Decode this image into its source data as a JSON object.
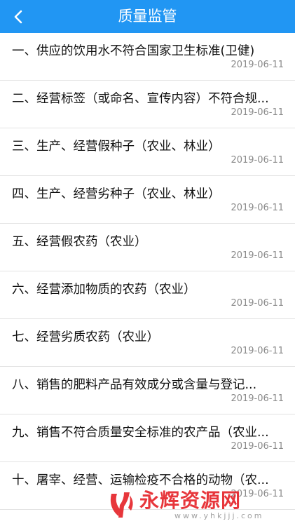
{
  "header": {
    "title": "质量监管",
    "back_icon": "chevron-left-icon",
    "color": "#2196F3"
  },
  "items": [
    {
      "title": "一、供应的饮用水不符合国家卫生标准(卫健)",
      "date": "2019-06-11"
    },
    {
      "title": "二、经营标签（或命名、宣传内容）不符合规...",
      "date": "2019-06-11"
    },
    {
      "title": "三、生产、经营假种子（农业、林业）",
      "date": "2019-06-11"
    },
    {
      "title": "四、生产、经营劣种子（农业、林业）",
      "date": "2019-06-11"
    },
    {
      "title": "五、经营假农药（农业）",
      "date": "2019-06-11"
    },
    {
      "title": "六、经营添加物质的农药（农业）",
      "date": "2019-06-11"
    },
    {
      "title": "七、经营劣质农药（农业）",
      "date": "2019-06-11"
    },
    {
      "title": "八、销售的肥料产品有效成分或含量与登记...",
      "date": "2019-06-11"
    },
    {
      "title": "九、销售不符合质量安全标准的农产品（农业...",
      "date": "2019-06-11"
    },
    {
      "title": "十、屠宰、经营、运输检疫不合格的动物（农...",
      "date": "2019-06-11"
    }
  ],
  "watermark": {
    "text": "永辉资源网",
    "url": "www.yhkjjj.com",
    "color": "#e5262b"
  }
}
